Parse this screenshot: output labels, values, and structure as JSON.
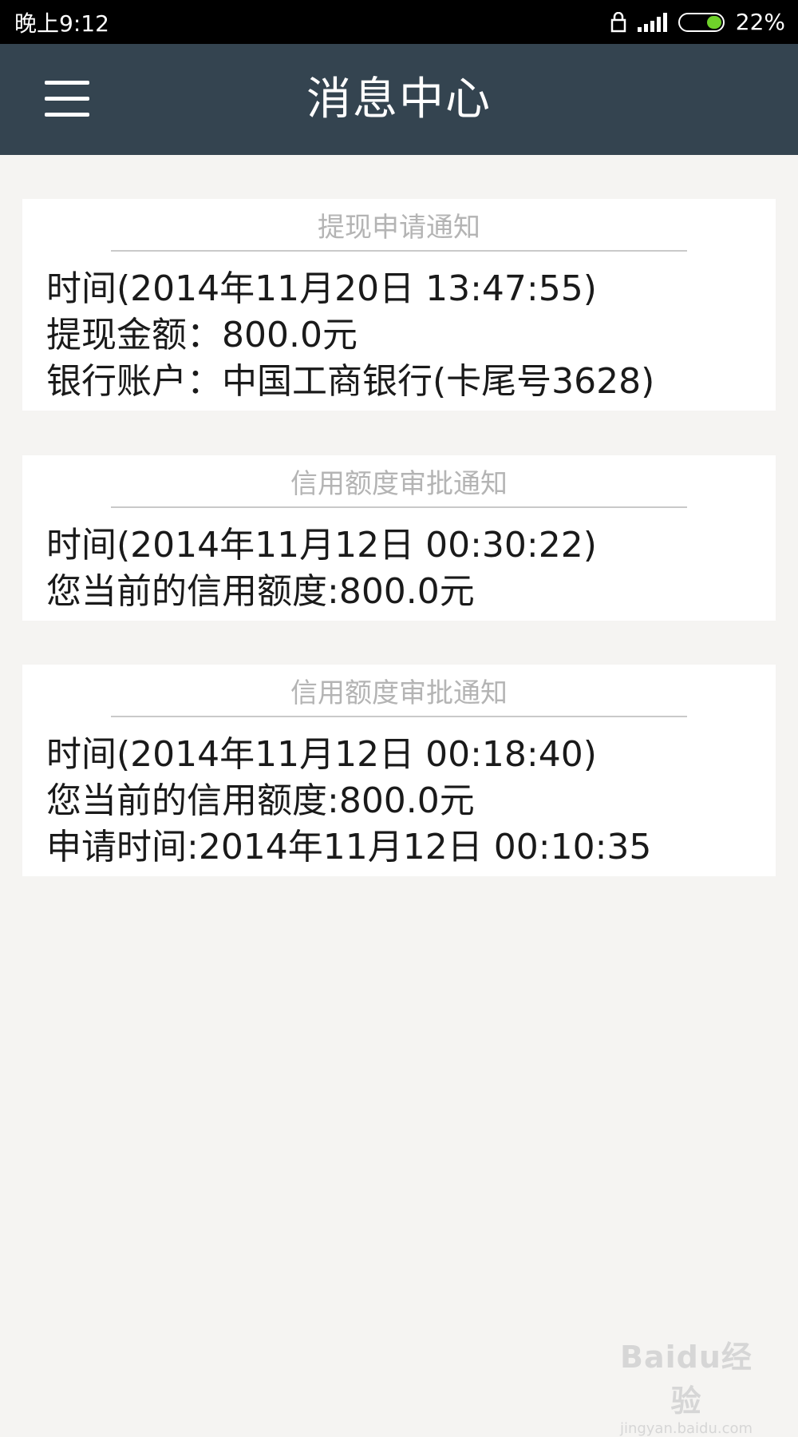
{
  "status_bar": {
    "time": "晚上9:12",
    "battery_percent": "22%",
    "battery_level": 0.22,
    "icons": [
      "lock-icon",
      "signal-icon",
      "battery-icon"
    ],
    "battery_color": "#6fd12a"
  },
  "app_bar": {
    "title": "消息中心",
    "menu_icon": "menu-icon",
    "background_color": "#344450"
  },
  "messages": [
    {
      "title": "提现申请通知",
      "lines": [
        "时间(2014年11月20日 13:47:55)",
        "提现金额：800.0元",
        "银行账户：中国工商银行(卡尾号3628)"
      ]
    },
    {
      "title": "信用额度审批通知",
      "lines": [
        "时间(2014年11月12日 00:30:22)",
        "您当前的信用额度:800.0元"
      ]
    },
    {
      "title": "信用额度审批通知",
      "lines": [
        "时间(2014年11月12日 00:18:40)",
        "您当前的信用额度:800.0元",
        "申请时间:2014年11月12日 00:10:35"
      ]
    }
  ],
  "watermark": {
    "main": "Baidu经验",
    "sub": "jingyan.baidu.com"
  }
}
